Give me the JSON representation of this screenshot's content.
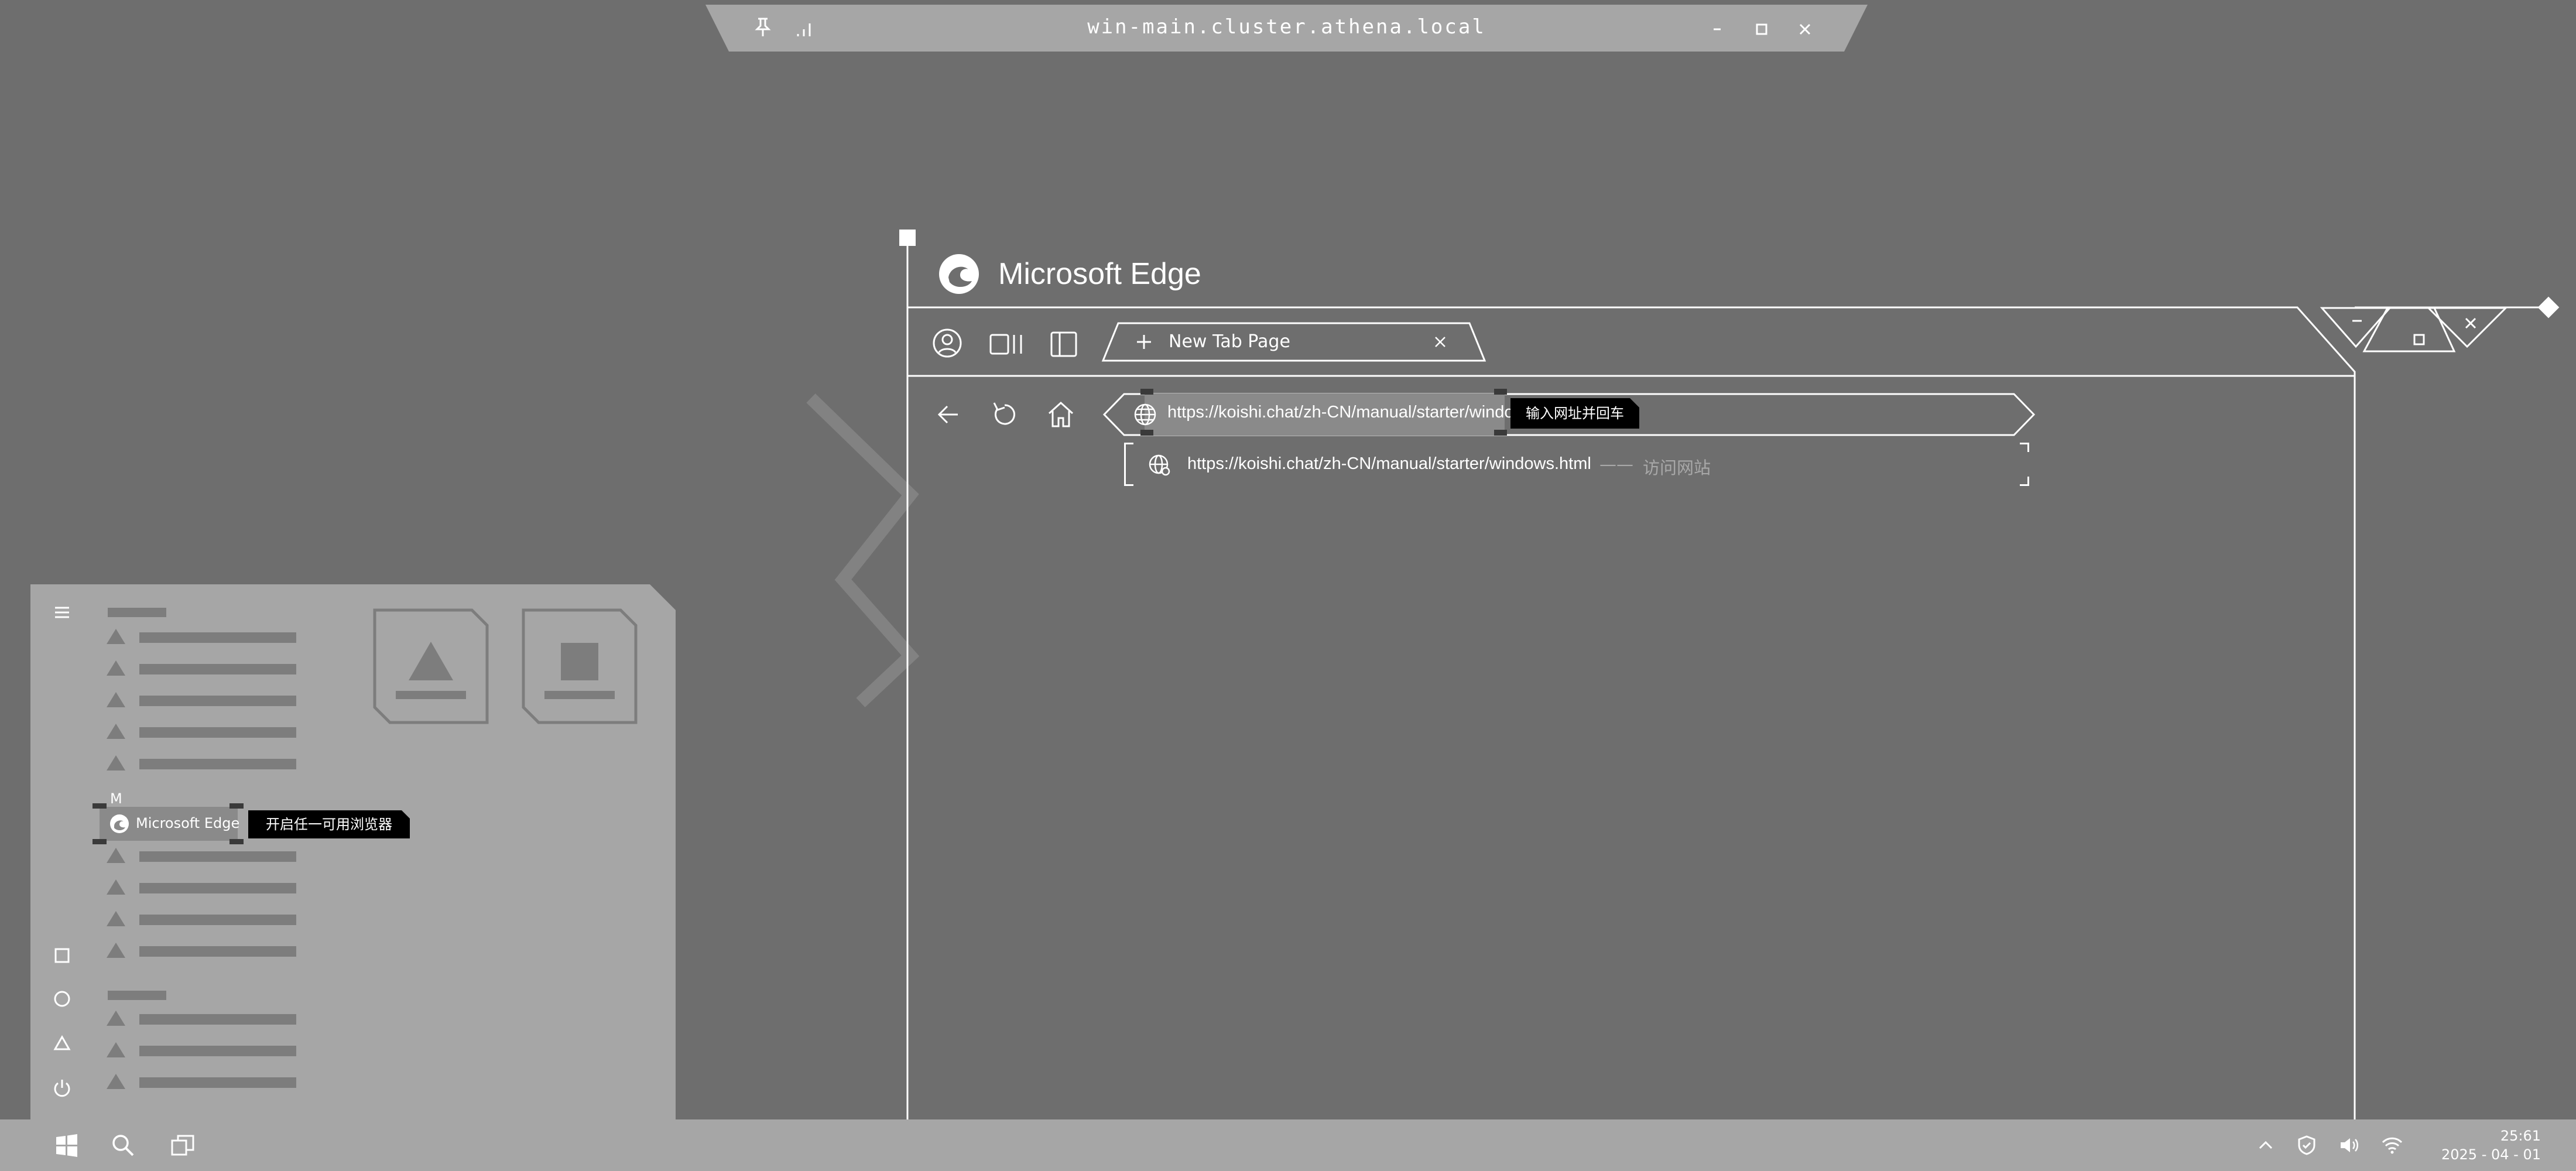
{
  "remote_bar": {
    "title": "win-main.cluster.athena.local",
    "icons": [
      "pin-icon",
      "signal-icon",
      "minimize-icon",
      "maximize-icon",
      "close-icon"
    ]
  },
  "edge": {
    "app_title": "Microsoft Edge",
    "tab": {
      "label": "New Tab Page",
      "icon": "plus-icon"
    },
    "address": {
      "value": "https://koishi.chat/zh-CN/manual/starter/windows.html"
    },
    "address_tip": "输入网址并回车",
    "suggestion": {
      "url": "https://koishi.chat/zh-CN/manual/starter/windows.html",
      "sep": "——",
      "action": "访问网站"
    }
  },
  "start_menu": {
    "section_letter": "M",
    "edge_item": "Microsoft Edge",
    "edge_tip": "开启任一可用浏览器"
  },
  "taskbar": {
    "time": "25:61",
    "date": "2025 - 04 - 01"
  },
  "colors": {
    "desktop": "#6e6e6e",
    "panel": "#a6a6a6",
    "line": "#ffffff",
    "tooltip": "#000000"
  }
}
